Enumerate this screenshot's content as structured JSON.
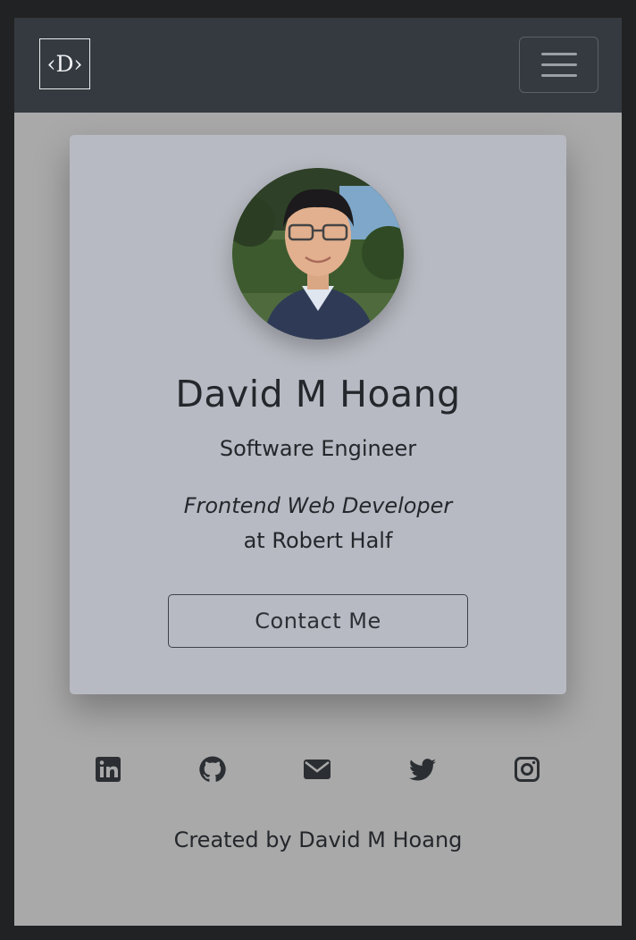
{
  "navbar": {
    "brand_label": "‹D›",
    "menu_icon": "hamburger-icon"
  },
  "profile": {
    "photo_alt": "David M Hoang",
    "name": "David M Hoang",
    "title": "Software Engineer",
    "role": "Frontend Web Developer",
    "company": "at Robert Half",
    "contact_label": "Contact Me"
  },
  "social": [
    {
      "icon": "linkedin-icon"
    },
    {
      "icon": "github-icon"
    },
    {
      "icon": "email-icon"
    },
    {
      "icon": "twitter-icon"
    },
    {
      "icon": "instagram-icon"
    }
  ],
  "footer": {
    "credit": "Created by David M Hoang"
  },
  "colors": {
    "navbar": "#343a40",
    "page_background": "#a9a9a9",
    "card_background": "#b8bac3",
    "text": "#24272b"
  }
}
